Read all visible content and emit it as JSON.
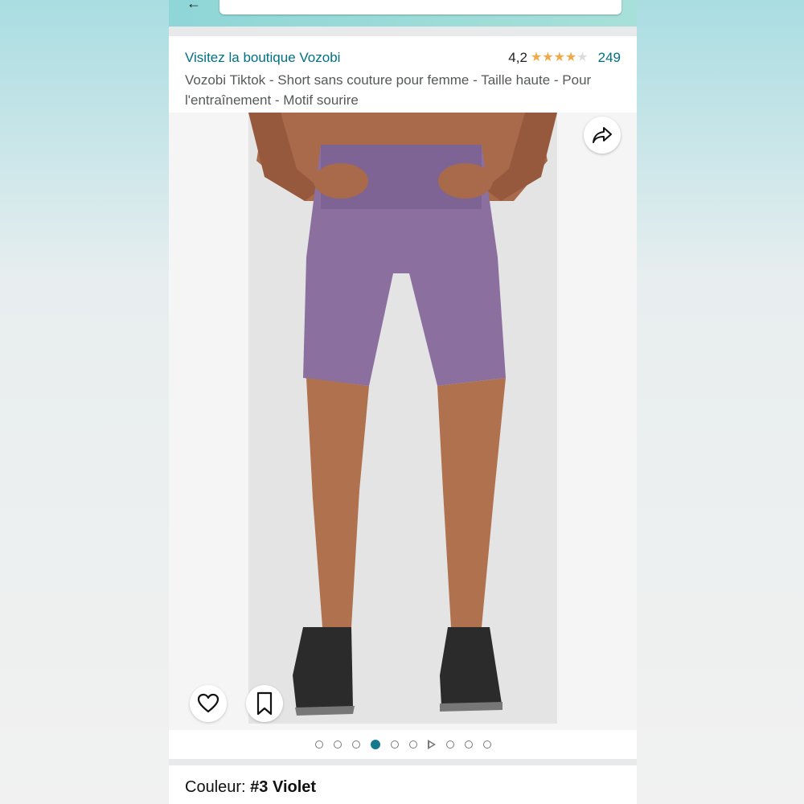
{
  "header": {
    "store_link": "Visitez la boutique Vozobi",
    "rating_value": "4,2",
    "rating_stars": 4.2,
    "review_count": "249",
    "product_title": "Vozobi Tiktok - Short sans couture pour femme - Taille haute - Pour l'entraînement - Motif sourire"
  },
  "gallery": {
    "image_count": 10,
    "active_index": 3,
    "video_index": 6,
    "short_color": "#8a6f9f",
    "skin_color": "#a86a4b",
    "shoe_color": "#2b2b2b"
  },
  "colors": {
    "link": "#007185",
    "star": "#f3a847",
    "active_dot": "#137a8c"
  },
  "variant": {
    "label": "Couleur:",
    "value": "#3 Violet"
  }
}
